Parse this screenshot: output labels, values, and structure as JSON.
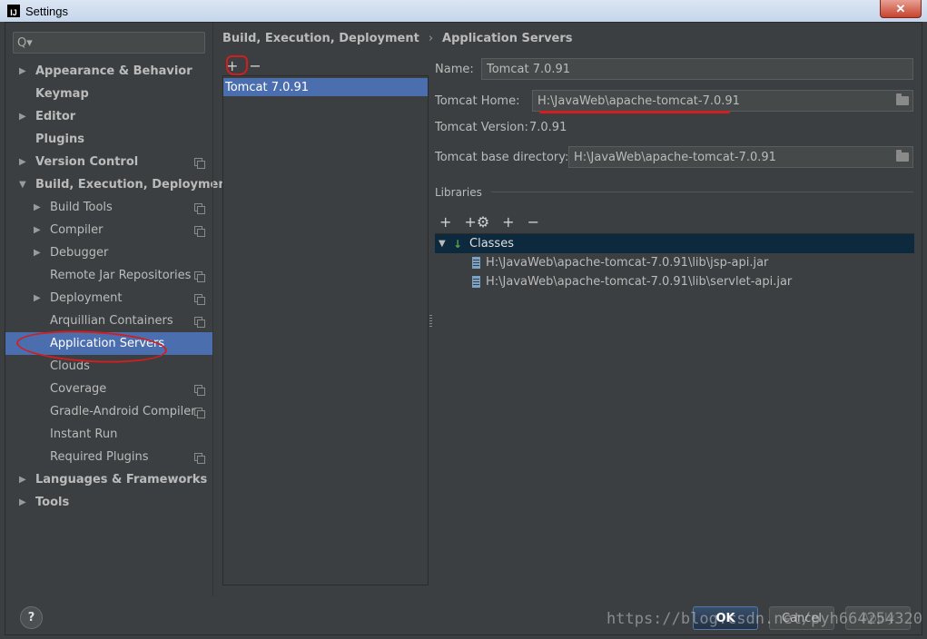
{
  "window": {
    "title": "Settings",
    "app_icon": "IJ",
    "close_label": "✕"
  },
  "search": {
    "icon": "search-icon",
    "glyph": "Q▾",
    "value": ""
  },
  "sidebar": {
    "items": [
      {
        "label": "Appearance & Behavior",
        "level": 0,
        "arrow": "▶",
        "copy": false
      },
      {
        "label": "Keymap",
        "level": 0,
        "arrow": "",
        "copy": false
      },
      {
        "label": "Editor",
        "level": 0,
        "arrow": "▶",
        "copy": false
      },
      {
        "label": "Plugins",
        "level": 0,
        "arrow": "",
        "copy": false
      },
      {
        "label": "Version Control",
        "level": 0,
        "arrow": "▶",
        "copy": true
      },
      {
        "label": "Build, Execution, Deployment",
        "level": 0,
        "arrow": "▼",
        "copy": false
      },
      {
        "label": "Build Tools",
        "level": 1,
        "arrow": "▶",
        "copy": true
      },
      {
        "label": "Compiler",
        "level": 1,
        "arrow": "▶",
        "copy": true
      },
      {
        "label": "Debugger",
        "level": 1,
        "arrow": "▶",
        "copy": false
      },
      {
        "label": "Remote Jar Repositories",
        "level": 1,
        "arrow": "",
        "copy": true
      },
      {
        "label": "Deployment",
        "level": 1,
        "arrow": "▶",
        "copy": true
      },
      {
        "label": "Arquillian Containers",
        "level": 1,
        "arrow": "",
        "copy": true
      },
      {
        "label": "Application Servers",
        "level": 1,
        "arrow": "",
        "copy": false,
        "selected": true
      },
      {
        "label": "Clouds",
        "level": 1,
        "arrow": "",
        "copy": false
      },
      {
        "label": "Coverage",
        "level": 1,
        "arrow": "",
        "copy": true
      },
      {
        "label": "Gradle-Android Compiler",
        "level": 1,
        "arrow": "",
        "copy": true
      },
      {
        "label": "Instant Run",
        "level": 1,
        "arrow": "",
        "copy": false
      },
      {
        "label": "Required Plugins",
        "level": 1,
        "arrow": "",
        "copy": true
      },
      {
        "label": "Languages & Frameworks",
        "level": 0,
        "arrow": "▶",
        "copy": false
      },
      {
        "label": "Tools",
        "level": 0,
        "arrow": "▶",
        "copy": false
      }
    ]
  },
  "breadcrumb": {
    "parent": "Build, Execution, Deployment",
    "separator": "›",
    "current": "Application Servers"
  },
  "server_list": {
    "add_label": "+",
    "remove_label": "−",
    "items": [
      "Tomcat 7.0.91"
    ]
  },
  "form": {
    "name_label": "Name:",
    "name_value": "Tomcat 7.0.91",
    "home_label": "Tomcat Home:",
    "home_value": "H:\\JavaWeb\\apache-tomcat-7.0.91",
    "version_label": "Tomcat Version:",
    "version_value": "7.0.91",
    "base_label": "Tomcat base directory:",
    "base_value": "H:\\JavaWeb\\apache-tomcat-7.0.91"
  },
  "libraries": {
    "title": "Libraries",
    "toolbar": [
      "+",
      "+⚙",
      "+",
      "−"
    ],
    "classes_label": "Classes",
    "jars": [
      "H:\\JavaWeb\\apache-tomcat-7.0.91\\lib\\jsp-api.jar",
      "H:\\JavaWeb\\apache-tomcat-7.0.91\\lib\\servlet-api.jar"
    ]
  },
  "footer": {
    "help_label": "?",
    "ok_label": "OK",
    "cancel_label": "Cancel",
    "apply_label": "Apply"
  },
  "watermark": "https://blog.csdn.net/pyh664254320"
}
